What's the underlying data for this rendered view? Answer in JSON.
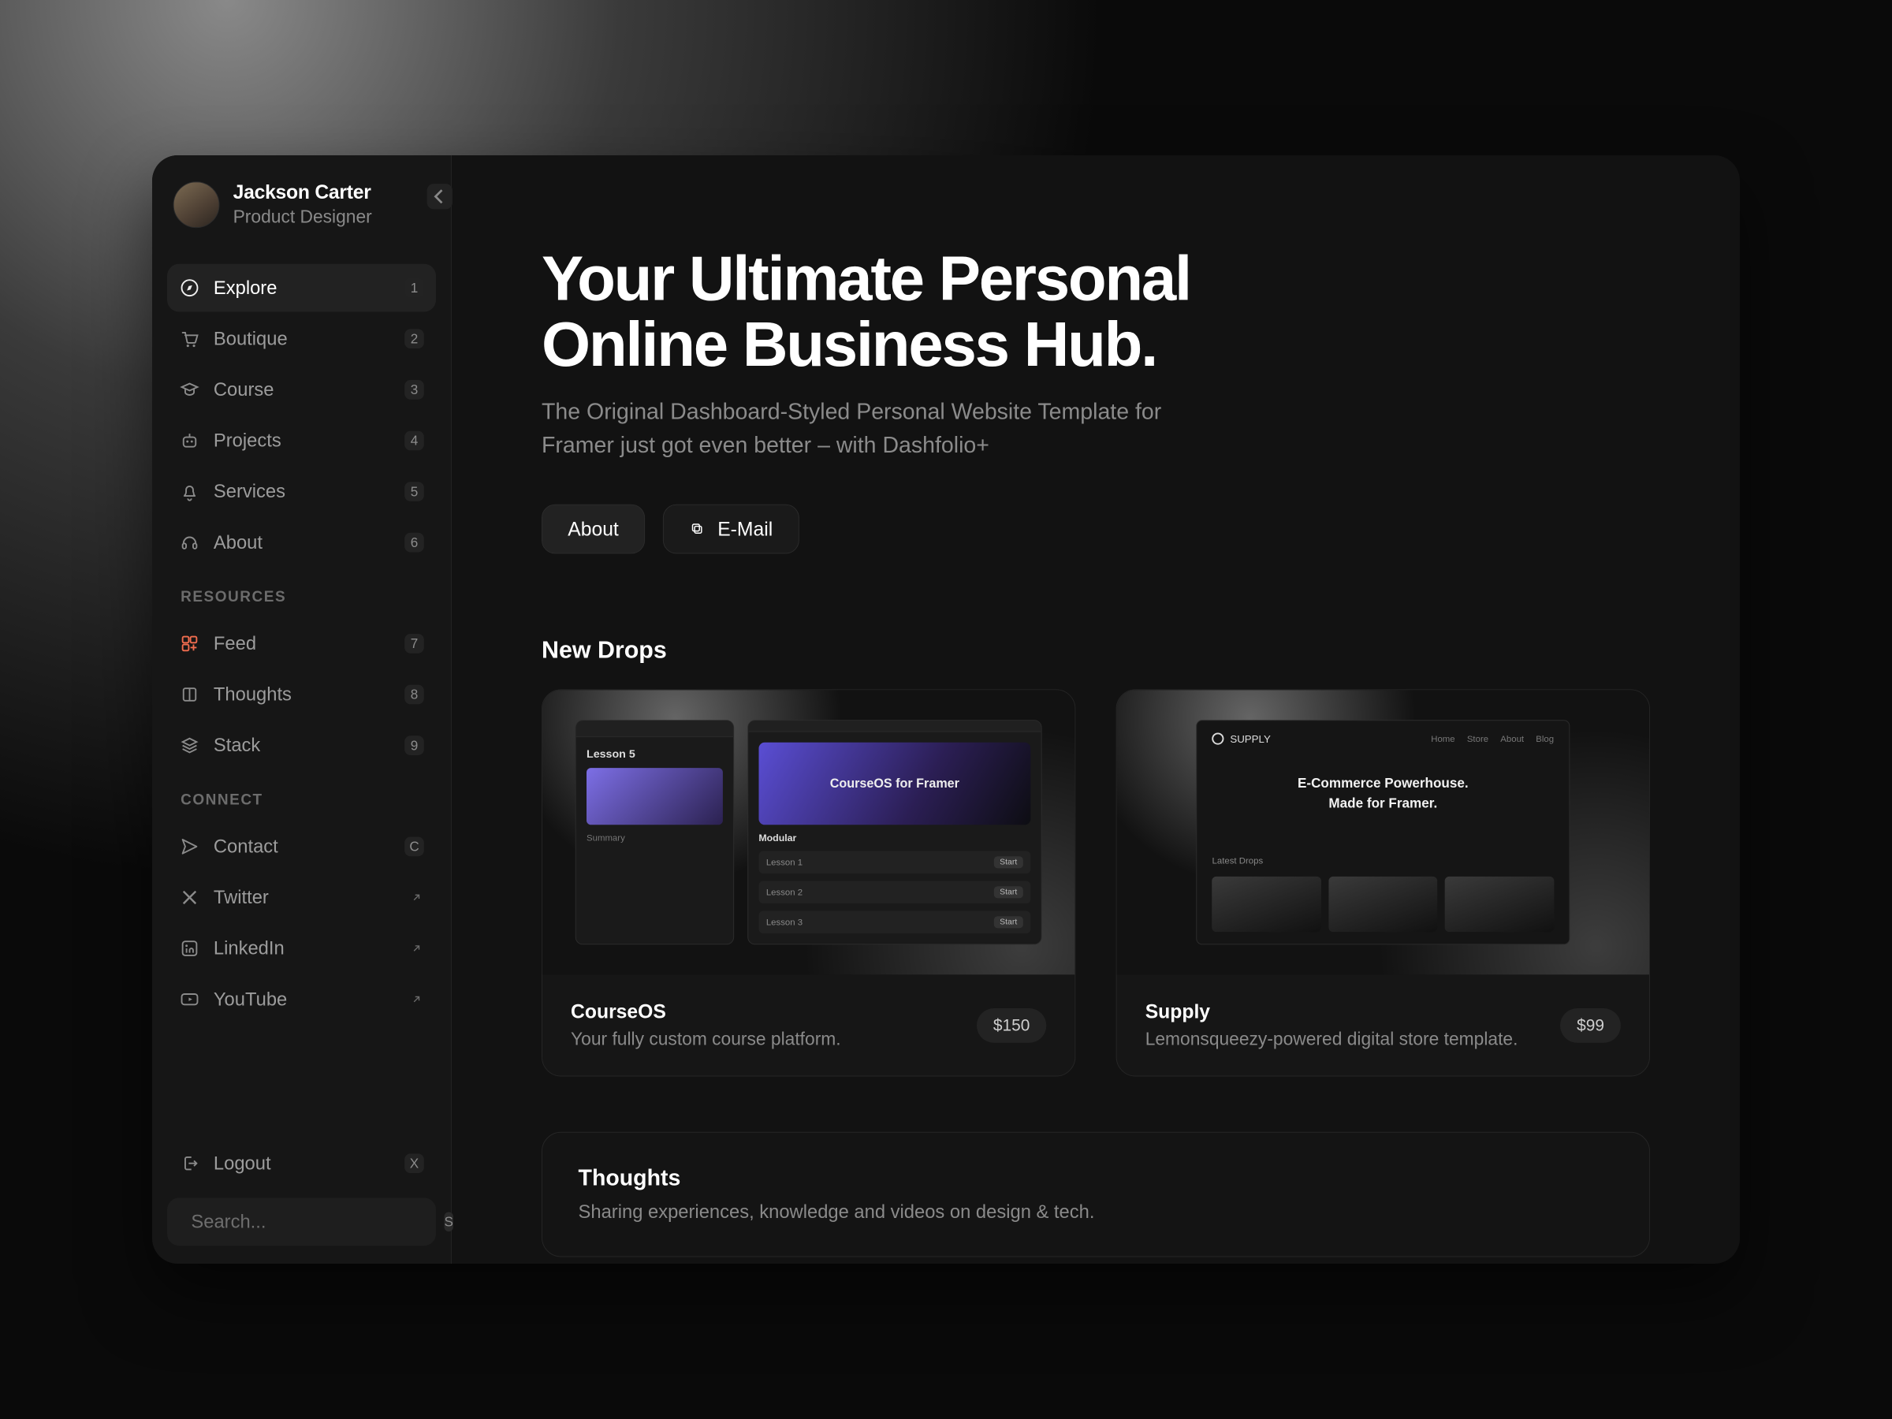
{
  "profile": {
    "name": "Jackson Carter",
    "role": "Product Designer"
  },
  "sidebar": {
    "nav": [
      {
        "label": "Explore",
        "key": "1",
        "icon": "compass-icon",
        "active": true
      },
      {
        "label": "Boutique",
        "key": "2",
        "icon": "cart-icon"
      },
      {
        "label": "Course",
        "key": "3",
        "icon": "graduation-icon"
      },
      {
        "label": "Projects",
        "key": "4",
        "icon": "robot-icon"
      },
      {
        "label": "Services",
        "key": "5",
        "icon": "bell-icon"
      },
      {
        "label": "About",
        "key": "6",
        "icon": "headphones-icon"
      }
    ],
    "resources_label": "RESOURCES",
    "resources": [
      {
        "label": "Feed",
        "key": "7",
        "icon": "widget-icon",
        "accent": true
      },
      {
        "label": "Thoughts",
        "key": "8",
        "icon": "book-icon"
      },
      {
        "label": "Stack",
        "key": "9",
        "icon": "layers-icon"
      }
    ],
    "connect_label": "CONNECT",
    "connect": [
      {
        "label": "Contact",
        "key": "C",
        "icon": "send-icon"
      },
      {
        "label": "Twitter",
        "icon": "x-logo-icon",
        "external": true
      },
      {
        "label": "LinkedIn",
        "icon": "linkedin-icon",
        "external": true
      },
      {
        "label": "YouTube",
        "icon": "youtube-icon",
        "external": true
      }
    ],
    "logout": {
      "label": "Logout",
      "key": "X"
    },
    "search_placeholder": "Search...",
    "search_key": "S"
  },
  "hero": {
    "title": "Your Ultimate Personal Online Business Hub.",
    "sub": "The Original Dashboard-Styled Personal Website Template for Framer just got even better – with Dashfolio+",
    "about": "About",
    "email": "E-Mail"
  },
  "drops": {
    "heading": "New Drops",
    "items": [
      {
        "title": "CourseOS",
        "desc": "Your fully custom course platform.",
        "price": "$150",
        "mock": {
          "lesson": "Lesson 5",
          "hero": "CourseOS for Framer",
          "hero_sub": "",
          "section": "Modular",
          "rows": [
            "Lesson 1",
            "Lesson 2",
            "Lesson 3"
          ],
          "row_action": "Start"
        }
      },
      {
        "title": "Supply",
        "desc": "Lemonsqueezy-powered digital store template.",
        "price": "$99",
        "mock": {
          "brand": "SUPPLY",
          "headline1": "E-Commerce Powerhouse.",
          "headline2": "Made for Framer.",
          "strip_label": "Latest Drops"
        }
      }
    ]
  },
  "thoughts": {
    "title": "Thoughts",
    "desc": "Sharing experiences, knowledge and videos on design & tech."
  }
}
